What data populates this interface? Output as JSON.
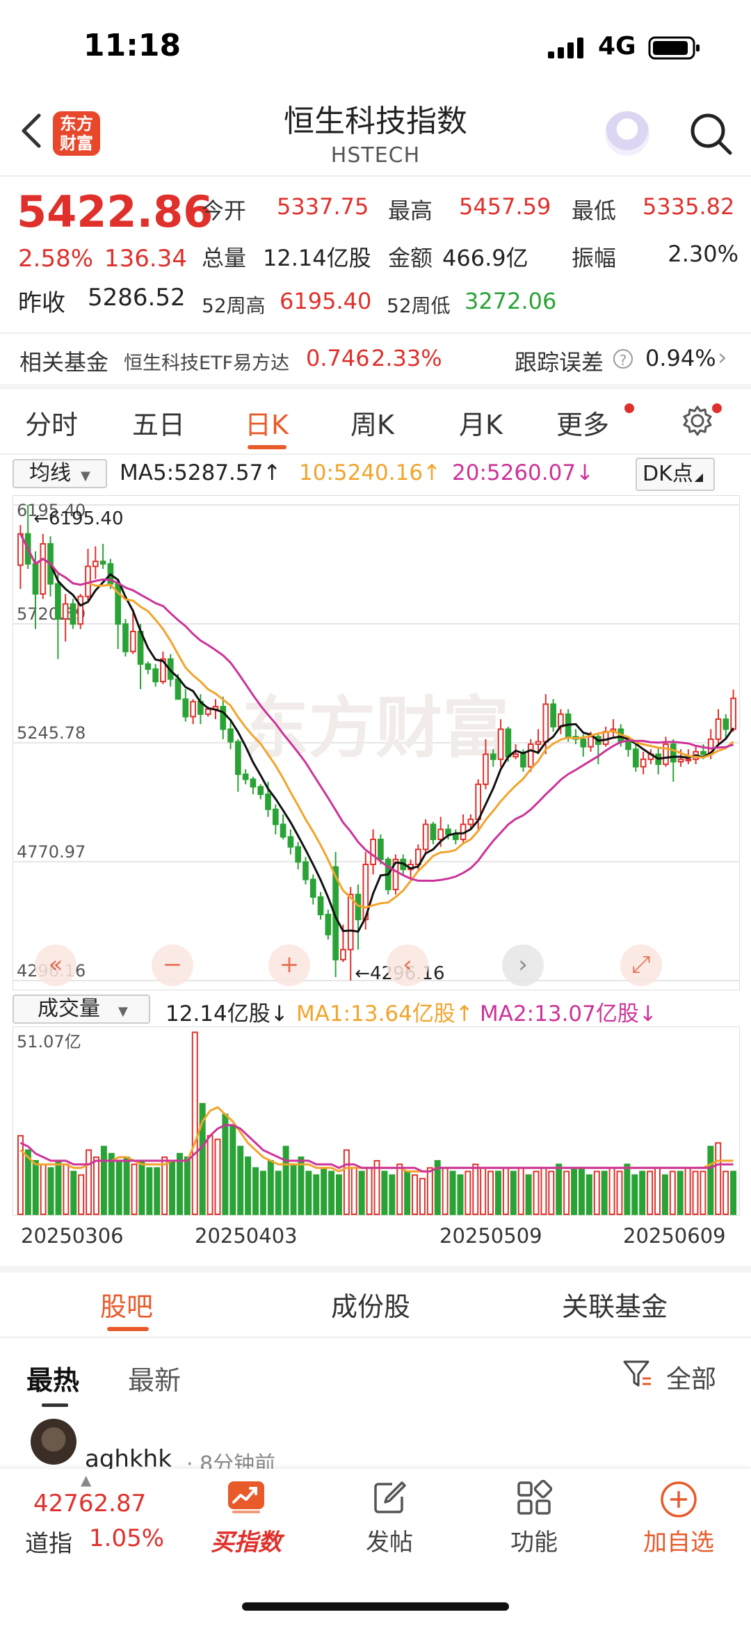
{
  "status_bar": {
    "time": "11:18",
    "network": "4G"
  },
  "header": {
    "title": "恒生科技指数",
    "subtitle": "HSTECH",
    "logo_text": "东方财富"
  },
  "quote": {
    "price": "5422.86",
    "change_pct": "2.58%",
    "change_amt": "136.34",
    "prev_close_label": "昨收",
    "prev_close": "5286.52",
    "open_label": "今开",
    "open": "5337.75",
    "high_label": "最高",
    "high": "5457.59",
    "low_label": "最低",
    "low": "5335.82",
    "volume_label": "总量",
    "volume": "12.14亿股",
    "amount_label": "金额",
    "amount": "466.9亿",
    "amplitude_label": "振幅",
    "amplitude": "2.30%",
    "w52_high_label": "52周高",
    "w52_high": "6195.40",
    "w52_low_label": "52周低",
    "w52_low": "3272.06"
  },
  "fund": {
    "label": "相关基金",
    "name": "恒生科技ETF易方达",
    "price": "0.746",
    "pct": "2.33%",
    "tracking_label": "跟踪误差",
    "tracking_value": "0.94%"
  },
  "period_tabs": [
    "分时",
    "五日",
    "日K",
    "周K",
    "月K",
    "更多"
  ],
  "active_period": "日K",
  "ma_row": {
    "selector": "均线",
    "ma5": "MA5:5287.57↑",
    "ma10": "10:5240.16↑",
    "ma20": "20:5260.07↓",
    "dk_button": "DK点"
  },
  "vol_row": {
    "selector": "成交量",
    "current": "12.14亿股↓",
    "ma1": "MA1:13.64亿股↑",
    "ma2": "MA2:13.07亿股↓"
  },
  "chart_data": [
    {
      "type": "candlestick",
      "y_ticks": [
        "6195.40",
        "5720.59",
        "5245.78",
        "4770.97",
        "4296.16"
      ],
      "ylim": [
        4296.16,
        6195.4
      ],
      "max_marker": "←6195.40",
      "min_marker": "←4296.16",
      "watermark": "东方财富",
      "x_tick_labels": [
        "20250306",
        "20250403",
        "20250509",
        "20250609"
      ],
      "candles": [
        [
          5955,
          6080,
          6115,
          5860
        ],
        [
          6080,
          5960,
          6195,
          5940
        ],
        [
          5960,
          5840,
          6010,
          5700
        ],
        [
          5840,
          6040,
          6080,
          5820
        ],
        [
          6040,
          5880,
          6070,
          5830
        ],
        [
          5880,
          5740,
          5920,
          5580
        ],
        [
          5740,
          5800,
          5840,
          5650
        ],
        [
          5800,
          5720,
          5820,
          5700
        ],
        [
          5720,
          5830,
          5840,
          5700
        ],
        [
          5830,
          5950,
          6020,
          5810
        ],
        [
          5950,
          5970,
          6030,
          5900
        ],
        [
          5970,
          5960,
          6040,
          5940
        ],
        [
          5960,
          5880,
          5980,
          5860
        ],
        [
          5880,
          5720,
          5900,
          5620
        ],
        [
          5720,
          5610,
          5740,
          5590
        ],
        [
          5610,
          5690,
          5780,
          5600
        ],
        [
          5690,
          5560,
          5720,
          5460
        ],
        [
          5560,
          5540,
          5570,
          5520
        ],
        [
          5540,
          5490,
          5560,
          5470
        ],
        [
          5490,
          5580,
          5610,
          5480
        ],
        [
          5580,
          5500,
          5600,
          5470
        ],
        [
          5500,
          5420,
          5520,
          5420
        ],
        [
          5420,
          5350,
          5460,
          5330
        ],
        [
          5350,
          5410,
          5420,
          5320
        ],
        [
          5410,
          5360,
          5440,
          5320
        ],
        [
          5360,
          5380,
          5390,
          5350
        ],
        [
          5380,
          5390,
          5420,
          5340
        ],
        [
          5390,
          5300,
          5430,
          5260
        ],
        [
          5300,
          5250,
          5330,
          5220
        ],
        [
          5250,
          5120,
          5260,
          5050
        ],
        [
          5120,
          5100,
          5140,
          5080
        ],
        [
          5100,
          5070,
          5110,
          5040
        ],
        [
          5070,
          5040,
          5080,
          5020
        ],
        [
          5040,
          4980,
          5090,
          4950
        ],
        [
          4980,
          4920,
          5000,
          4880
        ],
        [
          4920,
          4870,
          4960,
          4860
        ],
        [
          4870,
          4830,
          4900,
          4800
        ],
        [
          4830,
          4770,
          4850,
          4740
        ],
        [
          4770,
          4700,
          4790,
          4680
        ],
        [
          4700,
          4630,
          4720,
          4600
        ],
        [
          4630,
          4560,
          4650,
          4540
        ],
        [
          4560,
          4480,
          4580,
          4460
        ],
        [
          4750,
          4380,
          4810,
          4310
        ],
        [
          4380,
          4420,
          4520,
          4370
        ],
        [
          4420,
          4640,
          4670,
          4296
        ],
        [
          4640,
          4540,
          4680,
          4420
        ],
        [
          4540,
          4760,
          4810,
          4500
        ],
        [
          4760,
          4860,
          4900,
          4720
        ],
        [
          4860,
          4780,
          4880,
          4760
        ],
        [
          4780,
          4660,
          4790,
          4640
        ],
        [
          4660,
          4780,
          4800,
          4640
        ],
        [
          4780,
          4740,
          4800,
          4720
        ],
        [
          4740,
          4760,
          4780,
          4700
        ],
        [
          4760,
          4820,
          4840,
          4740
        ],
        [
          4820,
          4920,
          4940,
          4800
        ],
        [
          4920,
          4860,
          4930,
          4840
        ],
        [
          4860,
          4900,
          4950,
          4830
        ],
        [
          4900,
          4880,
          4920,
          4860
        ],
        [
          4880,
          4860,
          4900,
          4840
        ],
        [
          4860,
          4920,
          4960,
          4840
        ],
        [
          4920,
          4940,
          4960,
          4900
        ],
        [
          4940,
          5080,
          5100,
          4900
        ],
        [
          5080,
          5200,
          5260,
          5060
        ],
        [
          5200,
          5180,
          5220,
          5150
        ],
        [
          5180,
          5300,
          5340,
          5150
        ],
        [
          5300,
          5190,
          5310,
          5170
        ],
        [
          5190,
          5200,
          5240,
          5180
        ],
        [
          5200,
          5150,
          5220,
          5130
        ],
        [
          5150,
          5240,
          5260,
          5130
        ],
        [
          5240,
          5250,
          5300,
          5200
        ],
        [
          5250,
          5400,
          5440,
          5200
        ],
        [
          5400,
          5310,
          5420,
          5290
        ],
        [
          5310,
          5360,
          5380,
          5280
        ],
        [
          5360,
          5270,
          5380,
          5250
        ],
        [
          5270,
          5260,
          5300,
          5240
        ],
        [
          5260,
          5230,
          5280,
          5190
        ],
        [
          5230,
          5270,
          5290,
          5210
        ],
        [
          5270,
          5240,
          5280,
          5160
        ],
        [
          5240,
          5290,
          5310,
          5230
        ],
        [
          5290,
          5300,
          5340,
          5270
        ],
        [
          5300,
          5250,
          5320,
          5230
        ],
        [
          5250,
          5220,
          5260,
          5190
        ],
        [
          5220,
          5150,
          5240,
          5130
        ],
        [
          5150,
          5180,
          5210,
          5120
        ],
        [
          5180,
          5200,
          5220,
          5160
        ],
        [
          5200,
          5160,
          5230,
          5120
        ],
        [
          5160,
          5240,
          5270,
          5150
        ],
        [
          5240,
          5170,
          5260,
          5090
        ],
        [
          5170,
          5180,
          5220,
          5150
        ],
        [
          5180,
          5180,
          5220,
          5160
        ],
        [
          5180,
          5210,
          5230,
          5160
        ],
        [
          5210,
          5200,
          5240,
          5180
        ],
        [
          5200,
          5260,
          5300,
          5180
        ],
        [
          5260,
          5340,
          5380,
          5240
        ],
        [
          5340,
          5300,
          5360,
          5260
        ],
        [
          5300,
          5423,
          5458,
          5290
        ]
      ]
    },
    {
      "type": "bar",
      "title": "成交量",
      "y_tick": "51.07亿",
      "ylim": [
        0,
        51.07
      ],
      "values": [
        22,
        18,
        15,
        14,
        13,
        15,
        14,
        12,
        11,
        18,
        16,
        19,
        17,
        15,
        16,
        14,
        15,
        13,
        13,
        16,
        15,
        17,
        16,
        51,
        31,
        22,
        21,
        28,
        25,
        19,
        16,
        13,
        12,
        15,
        12,
        19,
        14,
        16,
        12,
        11,
        13,
        12,
        11,
        18,
        13,
        12,
        13,
        15,
        12,
        11,
        14,
        12,
        11,
        10,
        13,
        15,
        13,
        12,
        11,
        12,
        14,
        13,
        12,
        12,
        13,
        12,
        13,
        11,
        12,
        13,
        12,
        14,
        12,
        13,
        13,
        11,
        12,
        12,
        13,
        12,
        14,
        11,
        12,
        12,
        13,
        11,
        12,
        12,
        13,
        12,
        12,
        19,
        20,
        12,
        12
      ],
      "ma1": [
        18,
        16,
        14,
        14,
        14,
        14,
        14,
        13,
        13,
        14,
        15,
        15,
        15,
        16,
        16,
        15,
        14,
        14,
        14,
        14,
        15,
        15,
        15,
        20,
        26,
        29,
        30,
        28,
        26,
        23,
        20,
        18,
        16,
        15,
        14,
        14,
        14,
        14,
        14,
        13,
        13,
        13,
        12,
        13,
        13,
        13,
        13,
        13,
        13,
        13,
        13,
        12,
        12,
        12,
        12,
        13,
        13,
        13,
        13,
        13,
        13,
        13,
        13,
        13,
        13,
        13,
        13,
        13,
        13,
        13,
        13,
        13,
        13,
        13,
        13,
        13,
        13,
        13,
        13,
        13,
        13,
        13,
        13,
        13,
        13,
        13,
        13,
        13,
        13,
        13,
        13,
        14,
        15,
        15,
        15
      ],
      "ma2": [
        20,
        19,
        17,
        16,
        15,
        15,
        15,
        14,
        14,
        14,
        15,
        15,
        15,
        15,
        15,
        15,
        15,
        15,
        15,
        15,
        15,
        15,
        15,
        17,
        19,
        22,
        24,
        25,
        25,
        24,
        22,
        20,
        18,
        17,
        16,
        15,
        15,
        15,
        15,
        14,
        14,
        14,
        13,
        14,
        14,
        13,
        13,
        13,
        13,
        13,
        13,
        13,
        13,
        12,
        12,
        13,
        13,
        13,
        13,
        13,
        13,
        13,
        13,
        13,
        13,
        13,
        13,
        13,
        13,
        13,
        13,
        13,
        13,
        13,
        13,
        13,
        13,
        13,
        13,
        13,
        13,
        13,
        13,
        13,
        13,
        13,
        13,
        13,
        13,
        13,
        13,
        13,
        14,
        14,
        14
      ]
    }
  ],
  "section_tabs": [
    "股吧",
    "成份股",
    "关联基金"
  ],
  "feed_tabs": {
    "hot": "最热",
    "new": "最新",
    "filter": "全部"
  },
  "post": {
    "user": "aghkhk",
    "time": "· 8分钟前"
  },
  "bottom_bar": {
    "dj_value": "42762.87",
    "dj_label": "道指",
    "dj_pct": "1.05%",
    "buy": "买指数",
    "post": "发帖",
    "func": "功能",
    "watch": "加自选"
  },
  "colors": {
    "up": "#e0302b",
    "down": "#2aa336",
    "accent": "#e85a2a",
    "ma5": "#111111",
    "ma10": "#f2a42c",
    "ma20": "#cc3399"
  }
}
